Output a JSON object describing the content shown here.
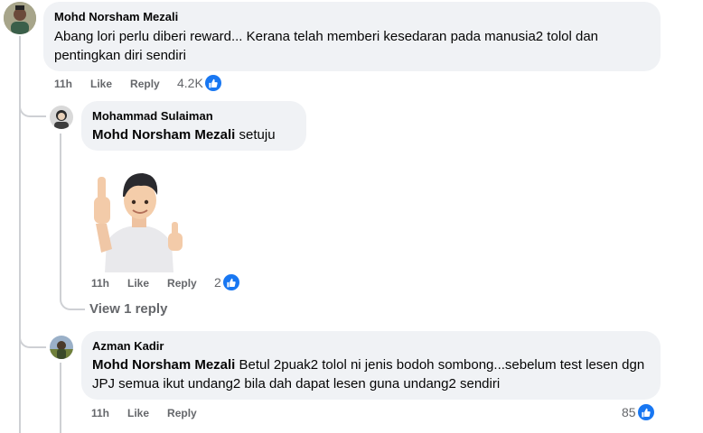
{
  "comments": [
    {
      "author": "Mohd Norsham Mezali",
      "text": "Abang lori perlu diberi reward... Kerana telah memberi kesedaran pada manusia2 tolol dan pentingkan diri sendiri",
      "time": "11h",
      "like_label": "Like",
      "reply_label": "Reply",
      "reactions": "4.2K"
    },
    {
      "author": "Mohammad Sulaiman",
      "mention": "Mohd Norsham Mezali",
      "text": "setuju",
      "time": "11h",
      "like_label": "Like",
      "reply_label": "Reply",
      "reactions": "2",
      "view_replies": "View 1 reply"
    },
    {
      "author": "Azman Kadir",
      "mention": "Mohd Norsham Mezali",
      "text": "Betul 2puak2 tolol ni jenis bodoh sombong...sebelum test lesen dgn JPJ semua ikut undang2 bila dah dapat lesen guna undang2 sendiri",
      "time": "11h",
      "like_label": "Like",
      "reply_label": "Reply",
      "reactions": "85"
    }
  ],
  "colors": {
    "bubble": "#f0f2f5",
    "meta_text": "#65676b",
    "like_blue": "#1877f2",
    "thread_line": "#ced0d4"
  },
  "icons": [
    "avatar",
    "like-reaction-icon",
    "thumbs-up-sticker"
  ]
}
